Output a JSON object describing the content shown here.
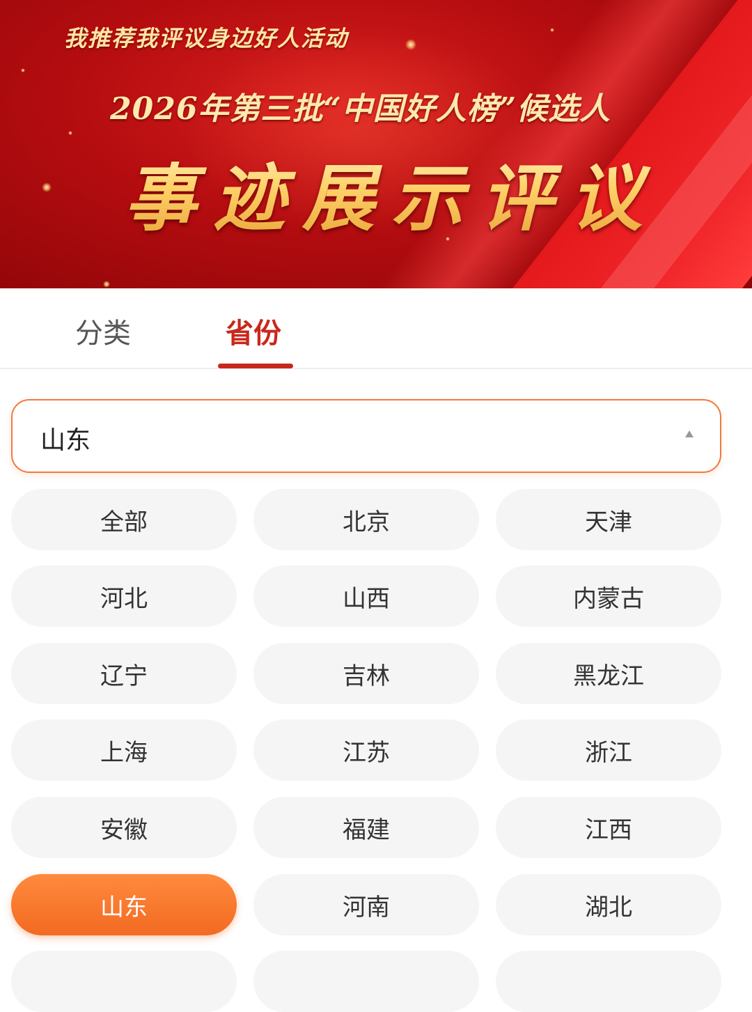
{
  "banner": {
    "tagline": "我推荐我评议身边好人活动",
    "subtitle": "2026年第三批“中国好人榜”候选人",
    "title": "事迹展示评议"
  },
  "tabs": [
    {
      "label": "分类",
      "active": false
    },
    {
      "label": "省份",
      "active": true
    }
  ],
  "select": {
    "value": "山东",
    "expanded": true
  },
  "provinces": [
    "全部",
    "北京",
    "天津",
    "河北",
    "山西",
    "内蒙古",
    "辽宁",
    "吉林",
    "黑龙江",
    "上海",
    "江苏",
    "浙江",
    "安徽",
    "福建",
    "江西",
    "山东",
    "河南",
    "湖北"
  ],
  "selected_province": "山东",
  "colors": {
    "accent": "#c8281b",
    "active_chip": "#f26a22",
    "select_border": "#f07a3e"
  }
}
